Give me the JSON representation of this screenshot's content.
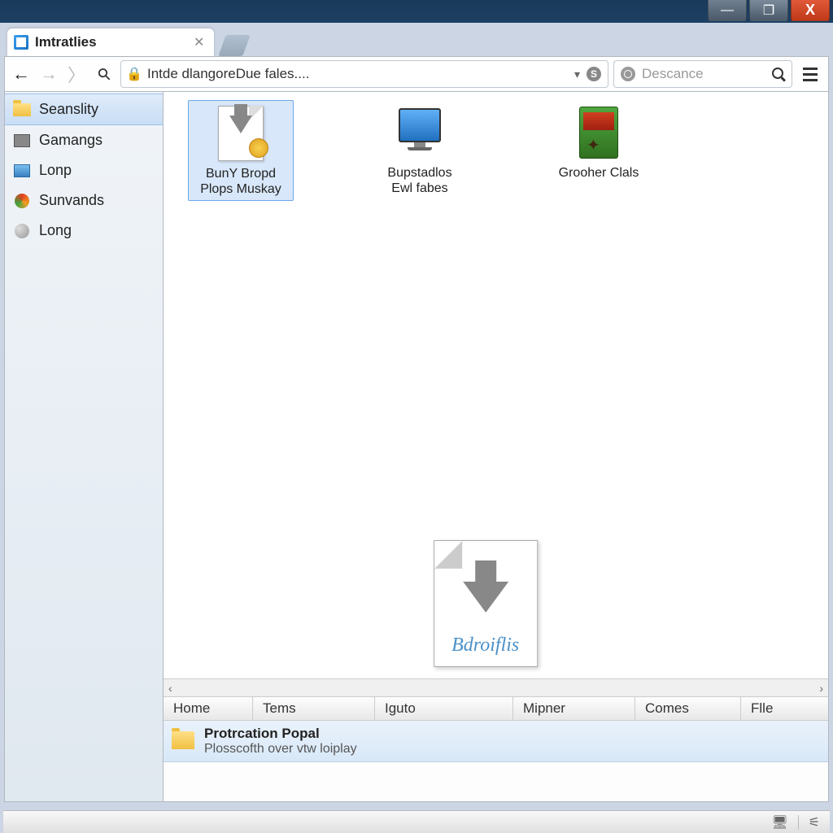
{
  "window": {
    "tab_title": "Imtratlies"
  },
  "toolbar": {
    "address": "Intde dlangoreDue fales....",
    "search_placeholder": "Descance"
  },
  "sidebar": {
    "items": [
      {
        "label": "Seanslity",
        "icon": "folder-yellow"
      },
      {
        "label": "Gamangs",
        "icon": "disk-gray"
      },
      {
        "label": "Lonp",
        "icon": "disk-blue"
      },
      {
        "label": "Sunvands",
        "icon": "orb-orange"
      },
      {
        "label": "Long",
        "icon": "orb-gray"
      }
    ]
  },
  "files": {
    "items": [
      {
        "label_line1": "BunY Bropd",
        "label_line2": "Plops Muskay"
      },
      {
        "label_line1": "Bupstadlos",
        "label_line2": "Ewl fabes"
      },
      {
        "label_line1": "Grooher Clals",
        "label_line2": ""
      }
    ],
    "big_icon_label": "Bdroiflis"
  },
  "details_header": {
    "cols": [
      "Home",
      "Tems",
      "Iguto",
      "Mipner",
      "Comes",
      "Flle"
    ]
  },
  "details_row": {
    "title": "Protrcation Popal",
    "subtitle": "Plosscofth over vtw loiplay"
  }
}
